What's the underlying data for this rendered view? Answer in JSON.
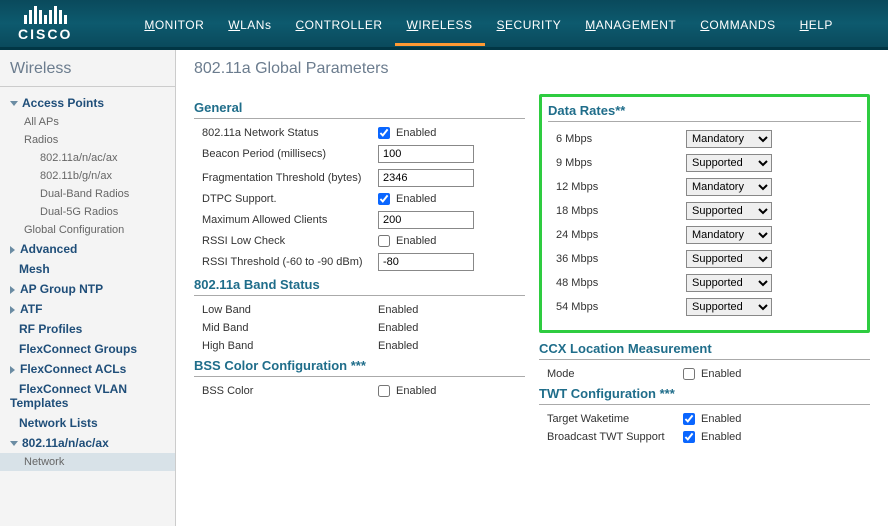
{
  "brand": "CISCO",
  "nav": [
    "MONITOR",
    "WLANs",
    "CONTROLLER",
    "WIRELESS",
    "SECURITY",
    "MANAGEMENT",
    "COMMANDS",
    "HELP"
  ],
  "nav_active": 3,
  "sidebar": {
    "title": "Wireless",
    "items": [
      {
        "label": "Access Points",
        "type": "exp",
        "children": [
          {
            "label": "All APs",
            "type": "leaf"
          },
          {
            "label": "Radios",
            "type": "exp-small",
            "children": [
              {
                "label": "802.11a/n/ac/ax"
              },
              {
                "label": "802.11b/g/n/ax"
              },
              {
                "label": "Dual-Band Radios"
              },
              {
                "label": "Dual-5G Radios"
              }
            ]
          },
          {
            "label": "Global Configuration",
            "type": "leaf"
          }
        ]
      },
      {
        "label": "Advanced",
        "type": "col"
      },
      {
        "label": "Mesh",
        "type": "bold"
      },
      {
        "label": "AP Group NTP",
        "type": "col"
      },
      {
        "label": "ATF",
        "type": "col"
      },
      {
        "label": "RF Profiles",
        "type": "bold"
      },
      {
        "label": "FlexConnect Groups",
        "type": "bold"
      },
      {
        "label": "FlexConnect ACLs",
        "type": "col"
      },
      {
        "label": "FlexConnect VLAN Templates",
        "type": "bold"
      },
      {
        "label": "Network Lists",
        "type": "bold"
      },
      {
        "label": "802.11a/n/ac/ax",
        "type": "exp",
        "children": [
          {
            "label": "Network",
            "type": "leaf",
            "active": true
          }
        ]
      }
    ]
  },
  "page_title": "802.11a Global Parameters",
  "sections": {
    "general": {
      "title": "General",
      "rows": {
        "network_status": {
          "label": "802.11a Network Status",
          "checked": true,
          "chk_label": "Enabled"
        },
        "beacon": {
          "label": "Beacon Period (millisecs)",
          "value": "100"
        },
        "frag": {
          "label": "Fragmentation Threshold (bytes)",
          "value": "2346"
        },
        "dtpc": {
          "label": "DTPC Support.",
          "checked": true,
          "chk_label": "Enabled"
        },
        "max_clients": {
          "label": "Maximum Allowed Clients",
          "value": "200"
        },
        "rssi_low": {
          "label": "RSSI Low Check",
          "checked": false,
          "chk_label": "Enabled"
        },
        "rssi_thresh": {
          "label": "RSSI Threshold (-60 to -90 dBm)",
          "value": "-80"
        }
      }
    },
    "band": {
      "title": "802.11a Band Status",
      "rows": [
        {
          "label": "Low Band",
          "value": "Enabled"
        },
        {
          "label": "Mid Band",
          "value": "Enabled"
        },
        {
          "label": "High Band",
          "value": "Enabled"
        }
      ]
    },
    "bss": {
      "title": "BSS Color Configuration ***",
      "row": {
        "label": "BSS Color",
        "checked": false,
        "chk_label": "Enabled"
      }
    },
    "rates": {
      "title": "Data Rates**",
      "rows": [
        {
          "label": "6 Mbps",
          "value": "Mandatory"
        },
        {
          "label": "9 Mbps",
          "value": "Supported"
        },
        {
          "label": "12 Mbps",
          "value": "Mandatory"
        },
        {
          "label": "18 Mbps",
          "value": "Supported"
        },
        {
          "label": "24 Mbps",
          "value": "Mandatory"
        },
        {
          "label": "36 Mbps",
          "value": "Supported"
        },
        {
          "label": "48 Mbps",
          "value": "Supported"
        },
        {
          "label": "54 Mbps",
          "value": "Supported"
        }
      ]
    },
    "ccx": {
      "title": "CCX Location Measurement",
      "row": {
        "label": "Mode",
        "checked": false,
        "chk_label": "Enabled"
      }
    },
    "twt": {
      "title": "TWT Configuration ***",
      "rows": [
        {
          "label": "Target Waketime",
          "checked": true,
          "chk_label": "Enabled"
        },
        {
          "label": "Broadcast TWT Support",
          "checked": true,
          "chk_label": "Enabled"
        }
      ]
    }
  }
}
